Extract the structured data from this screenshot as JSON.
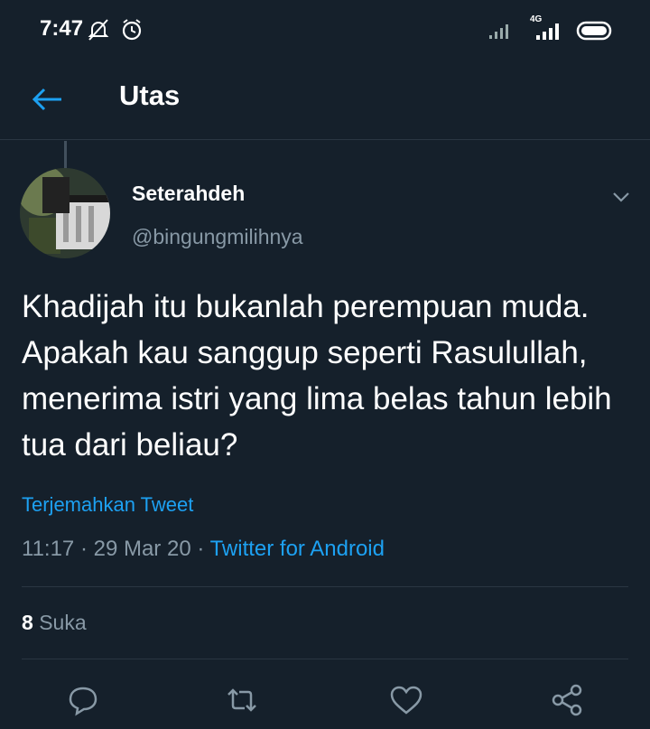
{
  "status_bar": {
    "time": "7:47",
    "network_label": "4G",
    "icons": [
      "notification-off-icon",
      "alarm-icon",
      "signal-icon",
      "signal-4g-icon",
      "battery-icon"
    ]
  },
  "header": {
    "title": "Utas",
    "back_icon": "arrow-left-icon"
  },
  "tweet": {
    "display_name": "Seterahdeh",
    "handle": "@bingungmilihnya",
    "text": "Khadijah itu bukanlah perempuan muda. Apakah kau sanggup seperti Rasulullah, menerima istri yang lima belas tahun lebih tua dari beliau?",
    "translate_label": "Terjemahkan Tweet",
    "timestamp": "11:17 · 29 Mar 20 · ",
    "source": "Twitter for Android",
    "likes_count": "8",
    "likes_label": "Suka"
  },
  "actions": [
    "reply-icon",
    "retweet-icon",
    "like-icon",
    "share-icon"
  ],
  "colors": {
    "background": "#15202b",
    "accent": "#1da1f2",
    "secondary_text": "#8899a6",
    "divider": "#2a3642"
  }
}
